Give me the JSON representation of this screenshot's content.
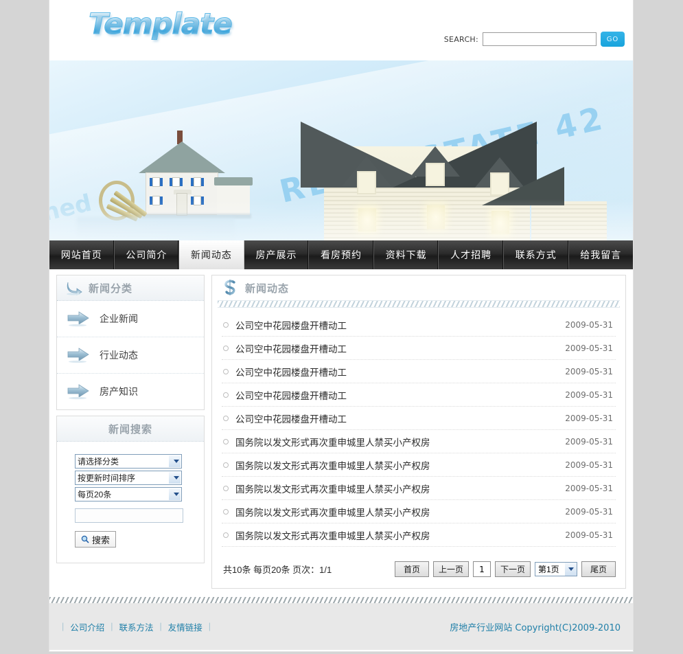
{
  "site": {
    "logo_text": "Template"
  },
  "header": {
    "search_label": "SEARCH:",
    "search_value": "",
    "search_placeholder": "",
    "go_label": "GO"
  },
  "banner": {
    "watermark": "REAL ESTATE 42",
    "watermark_big": "42",
    "watermark_left": "ned"
  },
  "nav": {
    "items": [
      {
        "label": "网站首页",
        "active": false
      },
      {
        "label": "公司简介",
        "active": false
      },
      {
        "label": "新闻动态",
        "active": true
      },
      {
        "label": "房产展示",
        "active": false
      },
      {
        "label": "看房预约",
        "active": false
      },
      {
        "label": "资料下载",
        "active": false
      },
      {
        "label": "人才招聘",
        "active": false
      },
      {
        "label": "联系方式",
        "active": false
      },
      {
        "label": "给我留言",
        "active": false
      }
    ]
  },
  "sidebar": {
    "category_panel": {
      "title": "新闻分类",
      "items": [
        {
          "label": "企业新闻"
        },
        {
          "label": "行业动态"
        },
        {
          "label": "房产知识"
        }
      ]
    },
    "search_panel": {
      "title": "新闻搜索",
      "select_category": "请选择分类",
      "select_sort": "按更新时间排序",
      "select_pagesize": "每页20条",
      "keyword_value": "",
      "keyword_placeholder": "",
      "search_button": "搜索"
    }
  },
  "main": {
    "title": "新闻动态",
    "news": [
      {
        "title": "公司空中花园楼盘开槽动工",
        "date": "2009-05-31"
      },
      {
        "title": "公司空中花园楼盘开槽动工",
        "date": "2009-05-31"
      },
      {
        "title": "公司空中花园楼盘开槽动工",
        "date": "2009-05-31"
      },
      {
        "title": "公司空中花园楼盘开槽动工",
        "date": "2009-05-31"
      },
      {
        "title": "公司空中花园楼盘开槽动工",
        "date": "2009-05-31"
      },
      {
        "title": "国务院以发文形式再次重申城里人禁买小产权房",
        "date": "2009-05-31"
      },
      {
        "title": "国务院以发文形式再次重申城里人禁买小产权房",
        "date": "2009-05-31"
      },
      {
        "title": "国务院以发文形式再次重申城里人禁买小产权房",
        "date": "2009-05-31"
      },
      {
        "title": "国务院以发文形式再次重申城里人禁买小产权房",
        "date": "2009-05-31"
      },
      {
        "title": "国务院以发文形式再次重申城里人禁买小产权房",
        "date": "2009-05-31"
      }
    ],
    "pager": {
      "info": "共10条 每页20条 页次：1/1",
      "first": "首页",
      "prev": "上一页",
      "current_page": "1",
      "next": "下一页",
      "page_select": "第1页",
      "last": "尾页"
    }
  },
  "footer": {
    "links": [
      {
        "label": "公司介绍"
      },
      {
        "label": "联系方法"
      },
      {
        "label": "友情链接"
      }
    ],
    "copyright": "房地产行业网站  Copyright(C)2009-2010"
  },
  "colors": {
    "accent_blue": "#29abe2",
    "link_blue": "#1f7fa8",
    "page_bg": "#d5d5d5",
    "nav_dark": "#2b2b2b"
  }
}
